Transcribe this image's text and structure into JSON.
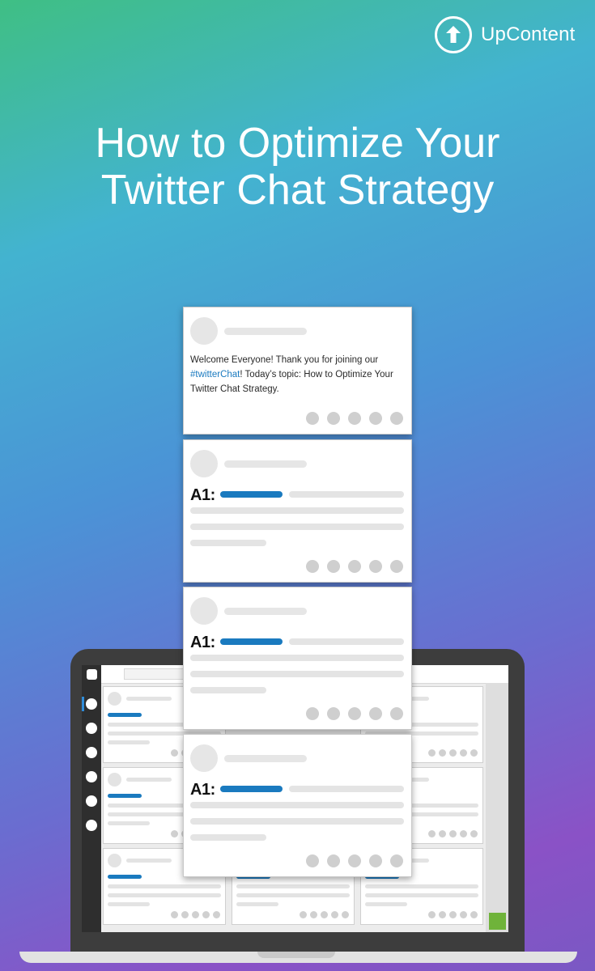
{
  "brand": {
    "name": "UpContent",
    "icon": "upload-arrow-icon"
  },
  "headline": {
    "line1": "How to Optimize Your",
    "line2": "Twitter Chat Strategy"
  },
  "intro_tweet": {
    "text_before": "Welcome Everyone! Thank you for joining our ",
    "hashtag": "#twitterChat",
    "text_after": "! Today’s topic: How to Optimize Your Twitter Chat Strategy."
  },
  "answer_tweets": [
    {
      "label": "A1:"
    },
    {
      "label": "A1:"
    },
    {
      "label": "A1:"
    }
  ],
  "colors": {
    "accent_blue": "#1a7abf",
    "accent_green": "#6fb33a"
  }
}
